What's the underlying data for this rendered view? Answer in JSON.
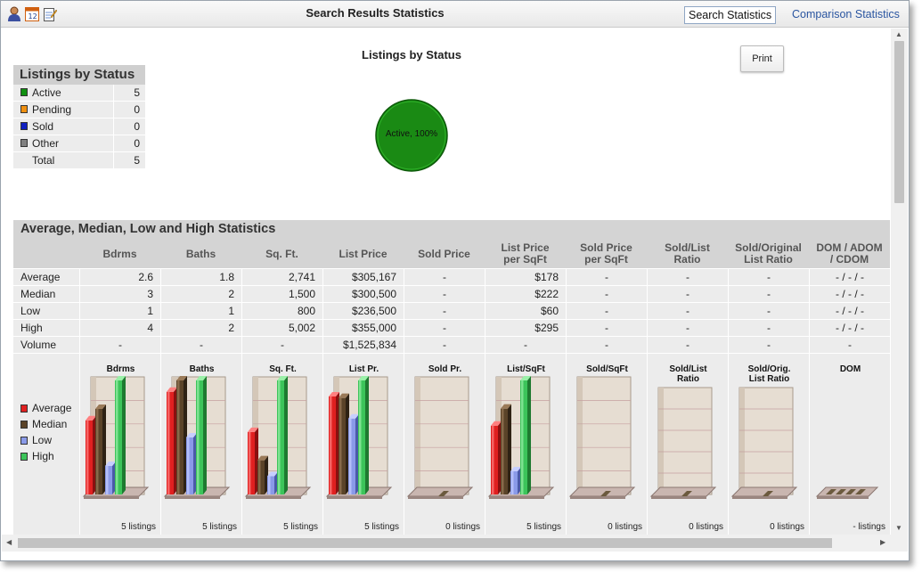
{
  "window": {
    "title": "Search Results Statistics",
    "tabs": [
      "Search Statistics",
      "Comparison Statistics"
    ],
    "icons": [
      "user-icon",
      "calendar-icon",
      "notepad-icon"
    ]
  },
  "status_panel": {
    "title": "Listings by Status",
    "rows": [
      {
        "label": "Active",
        "value": "5",
        "color": "#109010"
      },
      {
        "label": "Pending",
        "value": "0",
        "color": "#f09010"
      },
      {
        "label": "Sold",
        "value": "0",
        "color": "#1020c0"
      },
      {
        "label": "Other",
        "value": "0",
        "color": "#808080"
      }
    ],
    "total_label": "Total",
    "total_value": "5"
  },
  "pie": {
    "title": "Listings by Status",
    "slice_label": "Active, 100%",
    "color": "#1a8a14"
  },
  "print_label": "Print",
  "stats": {
    "title": "Average, Median, Low and High Statistics",
    "columns": [
      "Bdrms",
      "Baths",
      "Sq. Ft.",
      "List Price",
      "Sold Price",
      "List Price\nper SqFt",
      "Sold Price\nper SqFt",
      "Sold/List\nRatio",
      "Sold/Original\nList Ratio",
      "DOM / ADOM\n/ CDOM"
    ],
    "rows": [
      {
        "label": "Average",
        "cells": [
          "2.6",
          "1.8",
          "2,741",
          "$305,167",
          "-",
          "$178",
          "-",
          "-",
          "-",
          "- / - / -"
        ]
      },
      {
        "label": "Median",
        "cells": [
          "3",
          "2",
          "1,500",
          "$300,500",
          "-",
          "$222",
          "-",
          "-",
          "-",
          "- / - / -"
        ]
      },
      {
        "label": "Low",
        "cells": [
          "1",
          "1",
          "800",
          "$236,500",
          "-",
          "$60",
          "-",
          "-",
          "-",
          "- / - / -"
        ]
      },
      {
        "label": "High",
        "cells": [
          "4",
          "2",
          "5,002",
          "$355,000",
          "-",
          "$295",
          "-",
          "-",
          "-",
          "- / - / -"
        ]
      },
      {
        "label": "Volume",
        "cells": [
          "-",
          "-",
          "-",
          "$1,525,834",
          "-",
          "-",
          "-",
          "-",
          "-",
          "-"
        ]
      }
    ]
  },
  "legend": [
    {
      "label": "Average",
      "color": "#e02020"
    },
    {
      "label": "Median",
      "color": "#5a4328"
    },
    {
      "label": "Low",
      "color": "#8a9ae8"
    },
    {
      "label": "High",
      "color": "#3cc45a"
    }
  ],
  "chart_data": [
    {
      "type": "bar",
      "title": "Bdrms",
      "categories": [
        "Average",
        "Median",
        "Low",
        "High"
      ],
      "values": [
        2.6,
        3,
        1,
        4
      ],
      "footer": "5 listings"
    },
    {
      "type": "bar",
      "title": "Baths",
      "categories": [
        "Average",
        "Median",
        "Low",
        "High"
      ],
      "values": [
        1.8,
        2,
        1,
        2
      ],
      "footer": "5 listings"
    },
    {
      "type": "bar",
      "title": "Sq. Ft.",
      "categories": [
        "Average",
        "Median",
        "Low",
        "High"
      ],
      "values": [
        2741,
        1500,
        800,
        5002
      ],
      "footer": "5 listings"
    },
    {
      "type": "bar",
      "title": "List Pr.",
      "categories": [
        "Average",
        "Median",
        "Low",
        "High"
      ],
      "values": [
        305167,
        300500,
        236500,
        355000
      ],
      "footer": "5 listings"
    },
    {
      "type": "bar",
      "title": "Sold Pr.",
      "categories": [
        "Average",
        "Median",
        "Low",
        "High"
      ],
      "values": [],
      "footer": "0 listings"
    },
    {
      "type": "bar",
      "title": "List/SqFt",
      "categories": [
        "Average",
        "Median",
        "Low",
        "High"
      ],
      "values": [
        178,
        222,
        60,
        295
      ],
      "footer": "5 listings"
    },
    {
      "type": "bar",
      "title": "Sold/SqFt",
      "categories": [
        "Average",
        "Median",
        "Low",
        "High"
      ],
      "values": [],
      "footer": "0 listings"
    },
    {
      "type": "bar",
      "title": "Sold/List\nRatio",
      "categories": [
        "Average",
        "Median",
        "Low",
        "High"
      ],
      "values": [],
      "footer": "0 listings"
    },
    {
      "type": "bar",
      "title": "Sold/Orig.\nList Ratio",
      "categories": [
        "Average",
        "Median",
        "Low",
        "High"
      ],
      "values": [],
      "footer": "0 listings"
    },
    {
      "type": "bar",
      "title": "DOM",
      "categories": [
        "Average",
        "Median",
        "Low",
        "High"
      ],
      "values": [],
      "footer": "- listings"
    }
  ]
}
